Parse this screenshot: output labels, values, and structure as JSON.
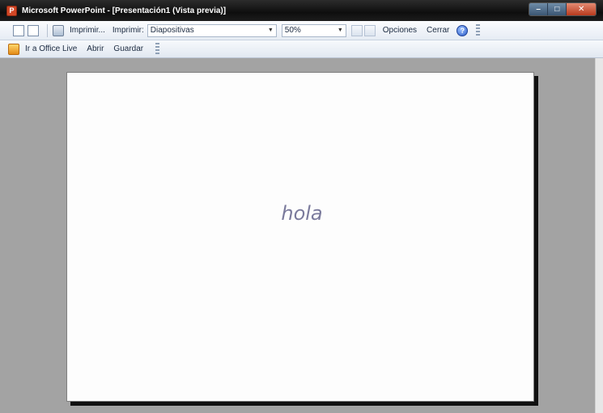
{
  "window": {
    "title": "Microsoft PowerPoint - [Presentación1 (Vista previa)]",
    "app_icon_letter": "P",
    "controls": {
      "minimize": "–",
      "maximize": "□",
      "close": "✕"
    }
  },
  "toolbar1": {
    "print_label": "Imprimir...",
    "print_what_label": "Imprimir:",
    "print_what_value": "Diapositivas",
    "zoom_value": "50%",
    "options_label": "Opciones",
    "close_label": "Cerrar",
    "help_glyph": "?"
  },
  "toolbar2": {
    "office_live_label": "Ir a Office Live",
    "open_label": "Abrir",
    "save_label": "Guardar"
  },
  "slide": {
    "text": "hola"
  },
  "icons": [
    "powerpoint-icon",
    "page-icon",
    "print-preview-icon",
    "print-icon",
    "help-icon",
    "office-live-icon"
  ]
}
